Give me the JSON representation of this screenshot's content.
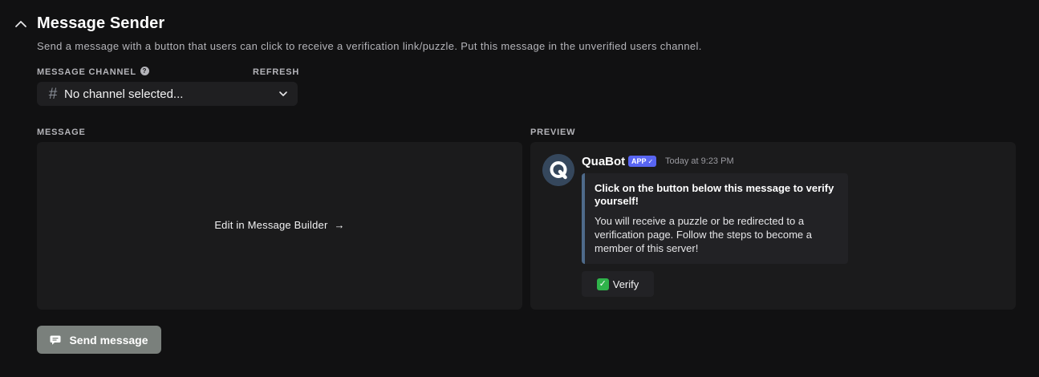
{
  "header": {
    "title": "Message Sender",
    "description": "Send a message with a button that users can click to receive a verification link/puzzle. Put this message in the unverified users channel.",
    "collapse_icon": "chevron-up-icon"
  },
  "channel": {
    "label": "MESSAGE CHANNEL",
    "help_icon": "question-circle-icon",
    "help_symbol": "?",
    "refresh_label": "REFRESH",
    "hash_symbol": "#",
    "selected_text": "No channel selected...",
    "dropdown_icon": "chevron-down-icon"
  },
  "message": {
    "label": "MESSAGE",
    "edit_label": "Edit in Message Builder",
    "arrow": "→"
  },
  "preview": {
    "label": "PREVIEW",
    "bot_name": "QuaBot",
    "badge": "APP",
    "badge_check": "✓",
    "timestamp": "Today at 9:23 PM",
    "embed_title": "Click on the button below this message to verify yourself!",
    "embed_description": "You will receive a puzzle or be redirected to a verification page. Follow the steps to become a member of this server!",
    "embed_color": "#4e6a8a",
    "button_emoji": "✓",
    "button_label": "Verify"
  },
  "actions": {
    "send_label": "Send message",
    "send_icon": "chat-bubble-icon"
  },
  "colors": {
    "background": "#111112",
    "panel": "#1b1b1c",
    "badge": "#5865f2",
    "send_button": "#7a807c",
    "verify_check": "#2fb34a"
  }
}
